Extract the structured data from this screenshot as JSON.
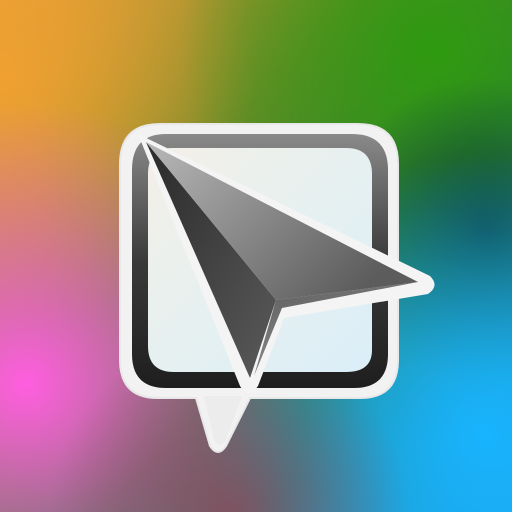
{
  "background": {
    "colors": {
      "top_left": "#e39a3a",
      "top_right": "#1f7a12",
      "mid_right": "#0e5a3a",
      "bottom_left": "#f06ad8",
      "bottom_right": "#1fb0f0",
      "bottom_center": "#7a4a60"
    }
  },
  "icon": {
    "name": "navigation-cursor-chat-icon",
    "frame_color": "#3a3a3a",
    "outline_color": "#f4f4f4",
    "arrow_dark": "#3c3c3c",
    "arrow_light": "#9a9a9a"
  }
}
